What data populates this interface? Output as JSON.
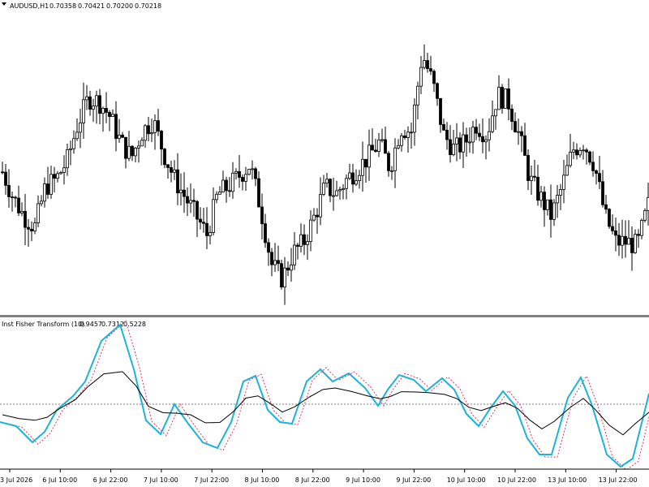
{
  "header": {
    "symbol": "AUDUSD,H1",
    "open": "0.70358",
    "high": "0.70421",
    "low": "0.70200",
    "close": "0.70218"
  },
  "indicator": {
    "name": "Inst Fisher Transform (10)",
    "values": [
      "0.9457",
      "0.7312",
      "0.5228"
    ]
  },
  "colors": {
    "candle": "#000000",
    "fisher": "#1ab4d8",
    "trigger": "#e0336e",
    "signal": "#000000",
    "zero_line": "#808080",
    "separator": "#808080"
  },
  "chart_data": [
    {
      "type": "candlestick",
      "title": "AUDUSD,H1",
      "x_tick_labels": [
        "3 Jul 2026",
        "6 Jul 10:00",
        "6 Jul 22:00",
        "7 Jul 10:00",
        "7 Jul 22:00",
        "8 Jul 10:00",
        "8 Jul 22:00",
        "9 Jul 10:00",
        "9 Jul 22:00",
        "10 Jul 10:00",
        "10 Jul 22:00",
        "13 Jul 10:00",
        "13 Jul 22:00"
      ],
      "close_path": [
        0.7022,
        0.7015,
        0.701,
        0.7007,
        0.7018,
        0.702,
        0.7025,
        0.7035,
        0.7042,
        0.7041,
        0.7037,
        0.703,
        0.7026,
        0.7033,
        0.7036,
        0.7027,
        0.702,
        0.7015,
        0.701,
        0.7005,
        0.7016,
        0.7018,
        0.7021,
        0.7024,
        0.7012,
        0.6997,
        0.6993,
        0.7,
        0.7003,
        0.701,
        0.7018,
        0.7016,
        0.702,
        0.7023,
        0.7026,
        0.703,
        0.7023,
        0.7034,
        0.7033,
        0.7054,
        0.7046,
        0.7032,
        0.7028,
        0.703,
        0.7035,
        0.7032,
        0.7043,
        0.7041,
        0.7032,
        0.702,
        0.7015,
        0.701,
        0.7018,
        0.7028,
        0.703,
        0.7024,
        0.701,
        0.7003,
        0.7003,
        0.7002,
        0.7013
      ],
      "series": [
        {
          "name": "Inst Fisher Transform (10)",
          "last": 0.9457
        },
        {
          "name": "",
          "last": 0.7312
        },
        {
          "name": "",
          "last": 0.5228
        }
      ]
    }
  ]
}
